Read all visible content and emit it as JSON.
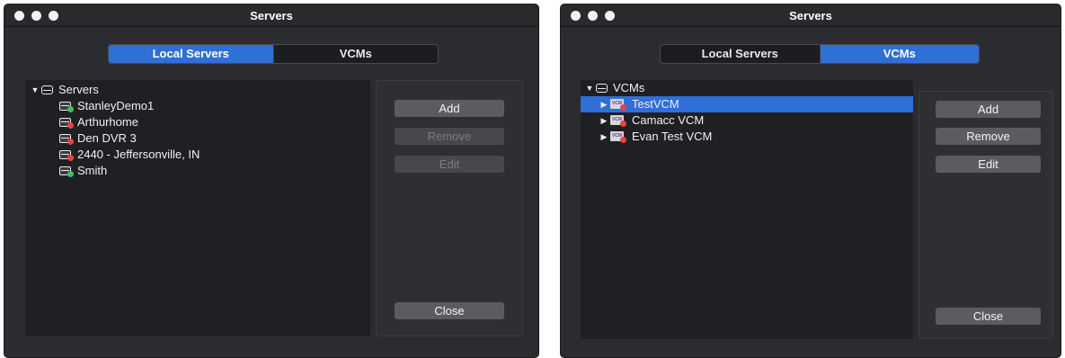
{
  "left_window": {
    "title": "Servers",
    "tabs": [
      {
        "label": "Local Servers",
        "active": true
      },
      {
        "label": "VCMs",
        "active": false
      }
    ],
    "tree_root": "Servers",
    "items": [
      {
        "label": "StanleyDemo1",
        "status": "online",
        "status_color": "#3cc35a"
      },
      {
        "label": "Arthurhome",
        "status": "offline",
        "status_color": "#e8453c"
      },
      {
        "label": "Den DVR 3",
        "status": "offline",
        "status_color": "#e8453c"
      },
      {
        "label": "2440 - Jeffersonville, IN",
        "status": "offline",
        "status_color": "#e8453c"
      },
      {
        "label": "Smith",
        "status": "online",
        "status_color": "#3cc35a"
      }
    ],
    "buttons": {
      "add": {
        "label": "Add",
        "enabled": true
      },
      "remove": {
        "label": "Remove",
        "enabled": false
      },
      "edit": {
        "label": "Edit",
        "enabled": false
      },
      "close": {
        "label": "Close",
        "enabled": true
      }
    }
  },
  "right_window": {
    "title": "Servers",
    "tabs": [
      {
        "label": "Local Servers",
        "active": false
      },
      {
        "label": "VCMs",
        "active": true
      }
    ],
    "tree_root": "VCMs",
    "items": [
      {
        "label": "TestVCM",
        "selected": true,
        "status_color": "#e8453c"
      },
      {
        "label": "Camacc VCM",
        "selected": false,
        "status_color": "#e8453c"
      },
      {
        "label": "Evan Test VCM",
        "selected": false,
        "status_color": "#e8453c"
      }
    ],
    "buttons": {
      "add": {
        "label": "Add",
        "enabled": true
      },
      "remove": {
        "label": "Remove",
        "enabled": true
      },
      "edit": {
        "label": "Edit",
        "enabled": true
      },
      "close": {
        "label": "Close",
        "enabled": true
      }
    }
  },
  "colors": {
    "accent": "#2f6fd8",
    "window_bg": "#2b2c30",
    "tree_bg": "#1f2024",
    "online": "#3cc35a",
    "offline": "#e8453c"
  }
}
